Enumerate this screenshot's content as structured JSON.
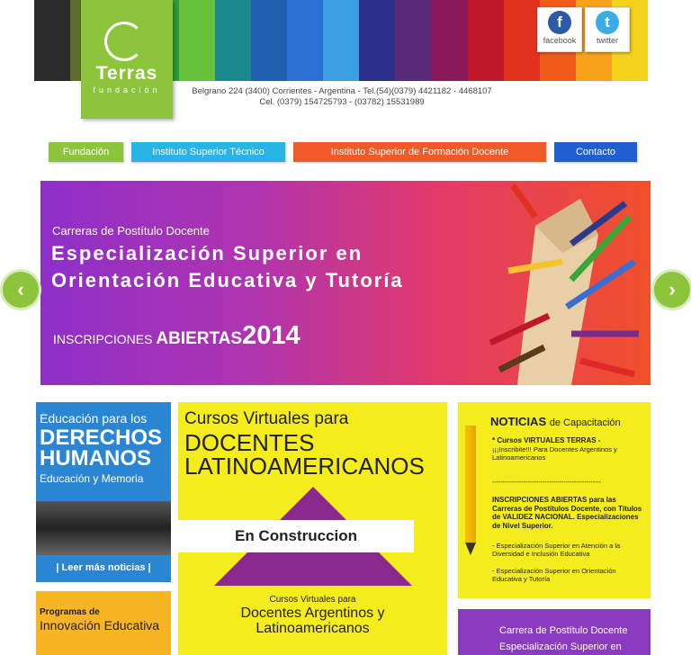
{
  "brand": {
    "name": "Terras",
    "subtitle": "fundación"
  },
  "header": {
    "address_line1": "Belgrano 224 (3400) Corrientes - Argentina - Tel.(54)(0379) 4421182 - 4468107",
    "address_line2": "Cel. (0379) 154725793 - (03782) 15531989",
    "stripe_colors": [
      "#2a2a2a",
      "#5e6b2a",
      "#1a6b3a",
      "#2f9e3a",
      "#66c23a",
      "#1a8a8f",
      "#1f5fb0",
      "#2a6fd1",
      "#3aa0e0",
      "#2c2f8a",
      "#5a2a7a",
      "#8a1a5a",
      "#c0182a",
      "#e0301e",
      "#f05a1a",
      "#f7a21a",
      "#f5d21a"
    ]
  },
  "social": {
    "facebook": {
      "icon": "facebook-icon",
      "glyph": "f",
      "label": "facebook",
      "color": "#2d5aa6"
    },
    "twitter": {
      "icon": "twitter-icon",
      "glyph": "t",
      "label": "twitter",
      "color": "#3aace6"
    }
  },
  "nav": [
    {
      "label": "Fundación",
      "color": "#8cc43c"
    },
    {
      "label": "Instituto Superior Técnico",
      "color": "#2ab4e6"
    },
    {
      "label": "Instituto Superior de Formación Docente",
      "color": "#f05a28"
    },
    {
      "label": "Contacto",
      "color": "#1f5fd0"
    }
  ],
  "hero": {
    "pre": "Carreras de Postítulo Docente",
    "title_line1": "Especialización Superior en",
    "title_line2": "Orientación Educativa y Tutoría",
    "insc_small": "INSCRIPCIONES",
    "insc_big": "ABIERTAS",
    "year": "2014",
    "prev": "‹",
    "next": "›"
  },
  "col1": {
    "line1": "Educación para los",
    "line2": "DERECHOS",
    "line3": "HUMANOS",
    "line4": "Educación y Memoria",
    "more": "| Leer más noticias |"
  },
  "col1b": {
    "line1": "Programas de",
    "line2": "Innovación Educativa"
  },
  "col2": {
    "line1": "Cursos Virtuales para",
    "line2": "DOCENTES",
    "line3": "LATINOAMERICANOS",
    "band": "En Construccion",
    "line4": "Cursos Virtuales para",
    "line5": "Docentes Argentinos y",
    "line6": "Latinoamericanos"
  },
  "col3": {
    "title": "NOTICIAS",
    "title_suffix": "de Capacitación",
    "n1_head": "* Cursos VIRTUALES TERRAS -",
    "n1_body": "¡¡¡Inscribite!!! Para Docentes Argentinos y Latinoamericanos",
    "separator": "----------------------------------------------------",
    "n2": "INSCRIPCIONES ABIERTAS para las Carreras de Postítulos Docente, con Títulos de VALIDEZ NACIONAL. Especializaciones de Nivel Superior.",
    "n3": "- Especialización Superior en Atención a la Diversidad e Inclusión Educativa",
    "n4": "- Especialización Superior en Orientación Educativa y Tutoría"
  },
  "col3b": {
    "line1": "Carrera de Postítulo Docente",
    "line2": "Especialización Superior en"
  }
}
